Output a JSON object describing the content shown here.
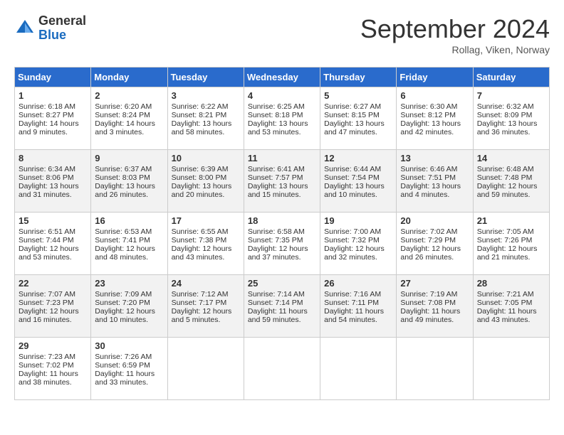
{
  "header": {
    "logo_general": "General",
    "logo_blue": "Blue",
    "month_title": "September 2024",
    "location": "Rollag, Viken, Norway"
  },
  "days_of_week": [
    "Sunday",
    "Monday",
    "Tuesday",
    "Wednesday",
    "Thursday",
    "Friday",
    "Saturday"
  ],
  "weeks": [
    [
      {
        "day": 1,
        "lines": [
          "Sunrise: 6:18 AM",
          "Sunset: 8:27 PM",
          "Daylight: 14 hours",
          "and 9 minutes."
        ]
      },
      {
        "day": 2,
        "lines": [
          "Sunrise: 6:20 AM",
          "Sunset: 8:24 PM",
          "Daylight: 14 hours",
          "and 3 minutes."
        ]
      },
      {
        "day": 3,
        "lines": [
          "Sunrise: 6:22 AM",
          "Sunset: 8:21 PM",
          "Daylight: 13 hours",
          "and 58 minutes."
        ]
      },
      {
        "day": 4,
        "lines": [
          "Sunrise: 6:25 AM",
          "Sunset: 8:18 PM",
          "Daylight: 13 hours",
          "and 53 minutes."
        ]
      },
      {
        "day": 5,
        "lines": [
          "Sunrise: 6:27 AM",
          "Sunset: 8:15 PM",
          "Daylight: 13 hours",
          "and 47 minutes."
        ]
      },
      {
        "day": 6,
        "lines": [
          "Sunrise: 6:30 AM",
          "Sunset: 8:12 PM",
          "Daylight: 13 hours",
          "and 42 minutes."
        ]
      },
      {
        "day": 7,
        "lines": [
          "Sunrise: 6:32 AM",
          "Sunset: 8:09 PM",
          "Daylight: 13 hours",
          "and 36 minutes."
        ]
      }
    ],
    [
      {
        "day": 8,
        "lines": [
          "Sunrise: 6:34 AM",
          "Sunset: 8:06 PM",
          "Daylight: 13 hours",
          "and 31 minutes."
        ]
      },
      {
        "day": 9,
        "lines": [
          "Sunrise: 6:37 AM",
          "Sunset: 8:03 PM",
          "Daylight: 13 hours",
          "and 26 minutes."
        ]
      },
      {
        "day": 10,
        "lines": [
          "Sunrise: 6:39 AM",
          "Sunset: 8:00 PM",
          "Daylight: 13 hours",
          "and 20 minutes."
        ]
      },
      {
        "day": 11,
        "lines": [
          "Sunrise: 6:41 AM",
          "Sunset: 7:57 PM",
          "Daylight: 13 hours",
          "and 15 minutes."
        ]
      },
      {
        "day": 12,
        "lines": [
          "Sunrise: 6:44 AM",
          "Sunset: 7:54 PM",
          "Daylight: 13 hours",
          "and 10 minutes."
        ]
      },
      {
        "day": 13,
        "lines": [
          "Sunrise: 6:46 AM",
          "Sunset: 7:51 PM",
          "Daylight: 13 hours",
          "and 4 minutes."
        ]
      },
      {
        "day": 14,
        "lines": [
          "Sunrise: 6:48 AM",
          "Sunset: 7:48 PM",
          "Daylight: 12 hours",
          "and 59 minutes."
        ]
      }
    ],
    [
      {
        "day": 15,
        "lines": [
          "Sunrise: 6:51 AM",
          "Sunset: 7:44 PM",
          "Daylight: 12 hours",
          "and 53 minutes."
        ]
      },
      {
        "day": 16,
        "lines": [
          "Sunrise: 6:53 AM",
          "Sunset: 7:41 PM",
          "Daylight: 12 hours",
          "and 48 minutes."
        ]
      },
      {
        "day": 17,
        "lines": [
          "Sunrise: 6:55 AM",
          "Sunset: 7:38 PM",
          "Daylight: 12 hours",
          "and 43 minutes."
        ]
      },
      {
        "day": 18,
        "lines": [
          "Sunrise: 6:58 AM",
          "Sunset: 7:35 PM",
          "Daylight: 12 hours",
          "and 37 minutes."
        ]
      },
      {
        "day": 19,
        "lines": [
          "Sunrise: 7:00 AM",
          "Sunset: 7:32 PM",
          "Daylight: 12 hours",
          "and 32 minutes."
        ]
      },
      {
        "day": 20,
        "lines": [
          "Sunrise: 7:02 AM",
          "Sunset: 7:29 PM",
          "Daylight: 12 hours",
          "and 26 minutes."
        ]
      },
      {
        "day": 21,
        "lines": [
          "Sunrise: 7:05 AM",
          "Sunset: 7:26 PM",
          "Daylight: 12 hours",
          "and 21 minutes."
        ]
      }
    ],
    [
      {
        "day": 22,
        "lines": [
          "Sunrise: 7:07 AM",
          "Sunset: 7:23 PM",
          "Daylight: 12 hours",
          "and 16 minutes."
        ]
      },
      {
        "day": 23,
        "lines": [
          "Sunrise: 7:09 AM",
          "Sunset: 7:20 PM",
          "Daylight: 12 hours",
          "and 10 minutes."
        ]
      },
      {
        "day": 24,
        "lines": [
          "Sunrise: 7:12 AM",
          "Sunset: 7:17 PM",
          "Daylight: 12 hours",
          "and 5 minutes."
        ]
      },
      {
        "day": 25,
        "lines": [
          "Sunrise: 7:14 AM",
          "Sunset: 7:14 PM",
          "Daylight: 11 hours",
          "and 59 minutes."
        ]
      },
      {
        "day": 26,
        "lines": [
          "Sunrise: 7:16 AM",
          "Sunset: 7:11 PM",
          "Daylight: 11 hours",
          "and 54 minutes."
        ]
      },
      {
        "day": 27,
        "lines": [
          "Sunrise: 7:19 AM",
          "Sunset: 7:08 PM",
          "Daylight: 11 hours",
          "and 49 minutes."
        ]
      },
      {
        "day": 28,
        "lines": [
          "Sunrise: 7:21 AM",
          "Sunset: 7:05 PM",
          "Daylight: 11 hours",
          "and 43 minutes."
        ]
      }
    ],
    [
      {
        "day": 29,
        "lines": [
          "Sunrise: 7:23 AM",
          "Sunset: 7:02 PM",
          "Daylight: 11 hours",
          "and 38 minutes."
        ]
      },
      {
        "day": 30,
        "lines": [
          "Sunrise: 7:26 AM",
          "Sunset: 6:59 PM",
          "Daylight: 11 hours",
          "and 33 minutes."
        ]
      },
      {
        "day": null,
        "lines": []
      },
      {
        "day": null,
        "lines": []
      },
      {
        "day": null,
        "lines": []
      },
      {
        "day": null,
        "lines": []
      },
      {
        "day": null,
        "lines": []
      }
    ]
  ]
}
